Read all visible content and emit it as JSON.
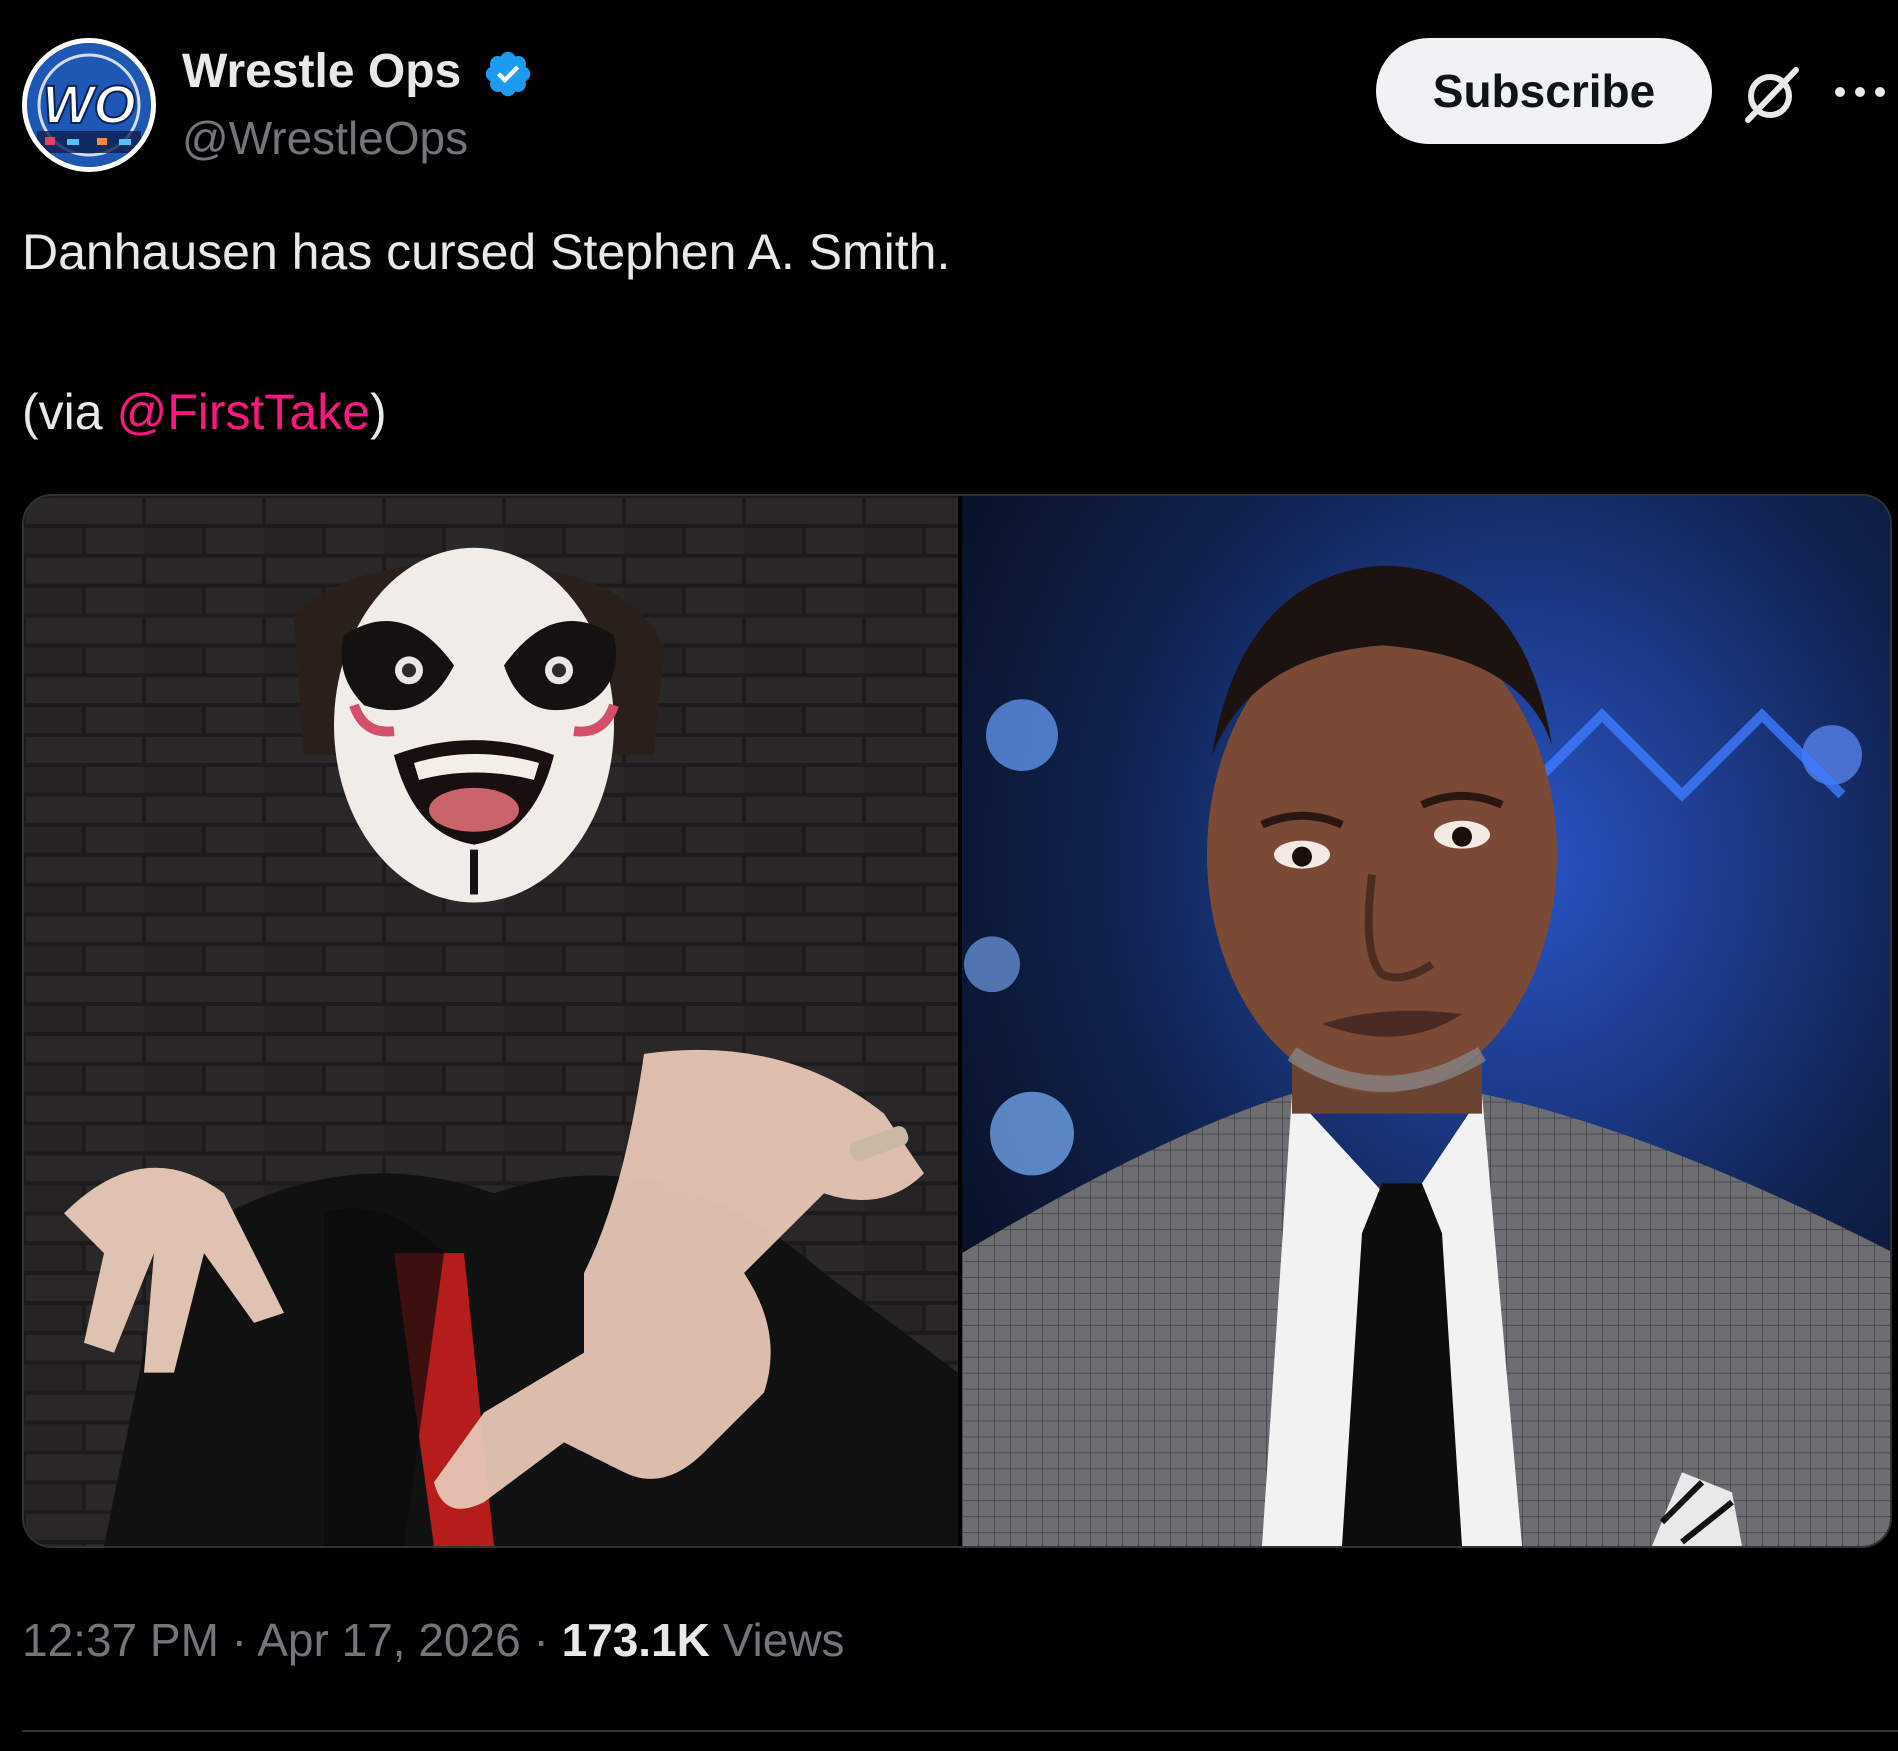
{
  "author": {
    "display_name": "Wrestle Ops",
    "handle": "@WrestleOps",
    "avatar_text": "WO",
    "verified": true
  },
  "actions": {
    "subscribe_label": "Subscribe",
    "grok_icon": "grok-icon",
    "more_icon": "more-icon"
  },
  "tweet": {
    "text_line1": "Danhausen has cursed Stephen A. Smith.",
    "via_prefix": "(via ",
    "via_mention": "@FirstTake",
    "via_suffix": ")"
  },
  "media": {
    "count": 2
  },
  "meta": {
    "time": "12:37 PM",
    "separator": " · ",
    "date": "Apr 17, 2026",
    "views_count": "173.1K",
    "views_label": " Views"
  },
  "colors": {
    "background": "#000000",
    "text_primary": "#e7e9ea",
    "text_secondary": "#71767b",
    "mention": "#f91880",
    "verified": "#1d9bf0",
    "button_bg": "#eff3f4"
  }
}
